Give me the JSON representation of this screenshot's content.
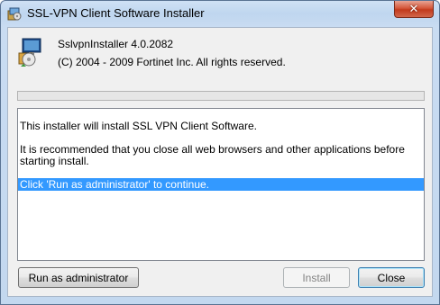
{
  "window": {
    "title": "SSL-VPN Client Software Installer",
    "close_glyph": "✕"
  },
  "header": {
    "app_name": "SslvpnInstaller 4.0.2082",
    "copyright": "(C) 2004 - 2009 Fortinet Inc. All rights reserved.",
    "icon": "installer-icon"
  },
  "progress": {
    "value_percent": 0
  },
  "log": {
    "lines": [
      "This installer will install SSL VPN Client Software.",
      "It is recommended that you close all web browsers and other applications before",
      "starting install.",
      "Click 'Run as administrator' to continue."
    ],
    "selected_index": 3
  },
  "buttons": {
    "run_as_admin": "Run as administrator",
    "install": "Install",
    "close": "Close"
  },
  "colors": {
    "selection": "#3399ff",
    "title_bar": "#c3d8ef",
    "close_button": "#c23a1c"
  }
}
